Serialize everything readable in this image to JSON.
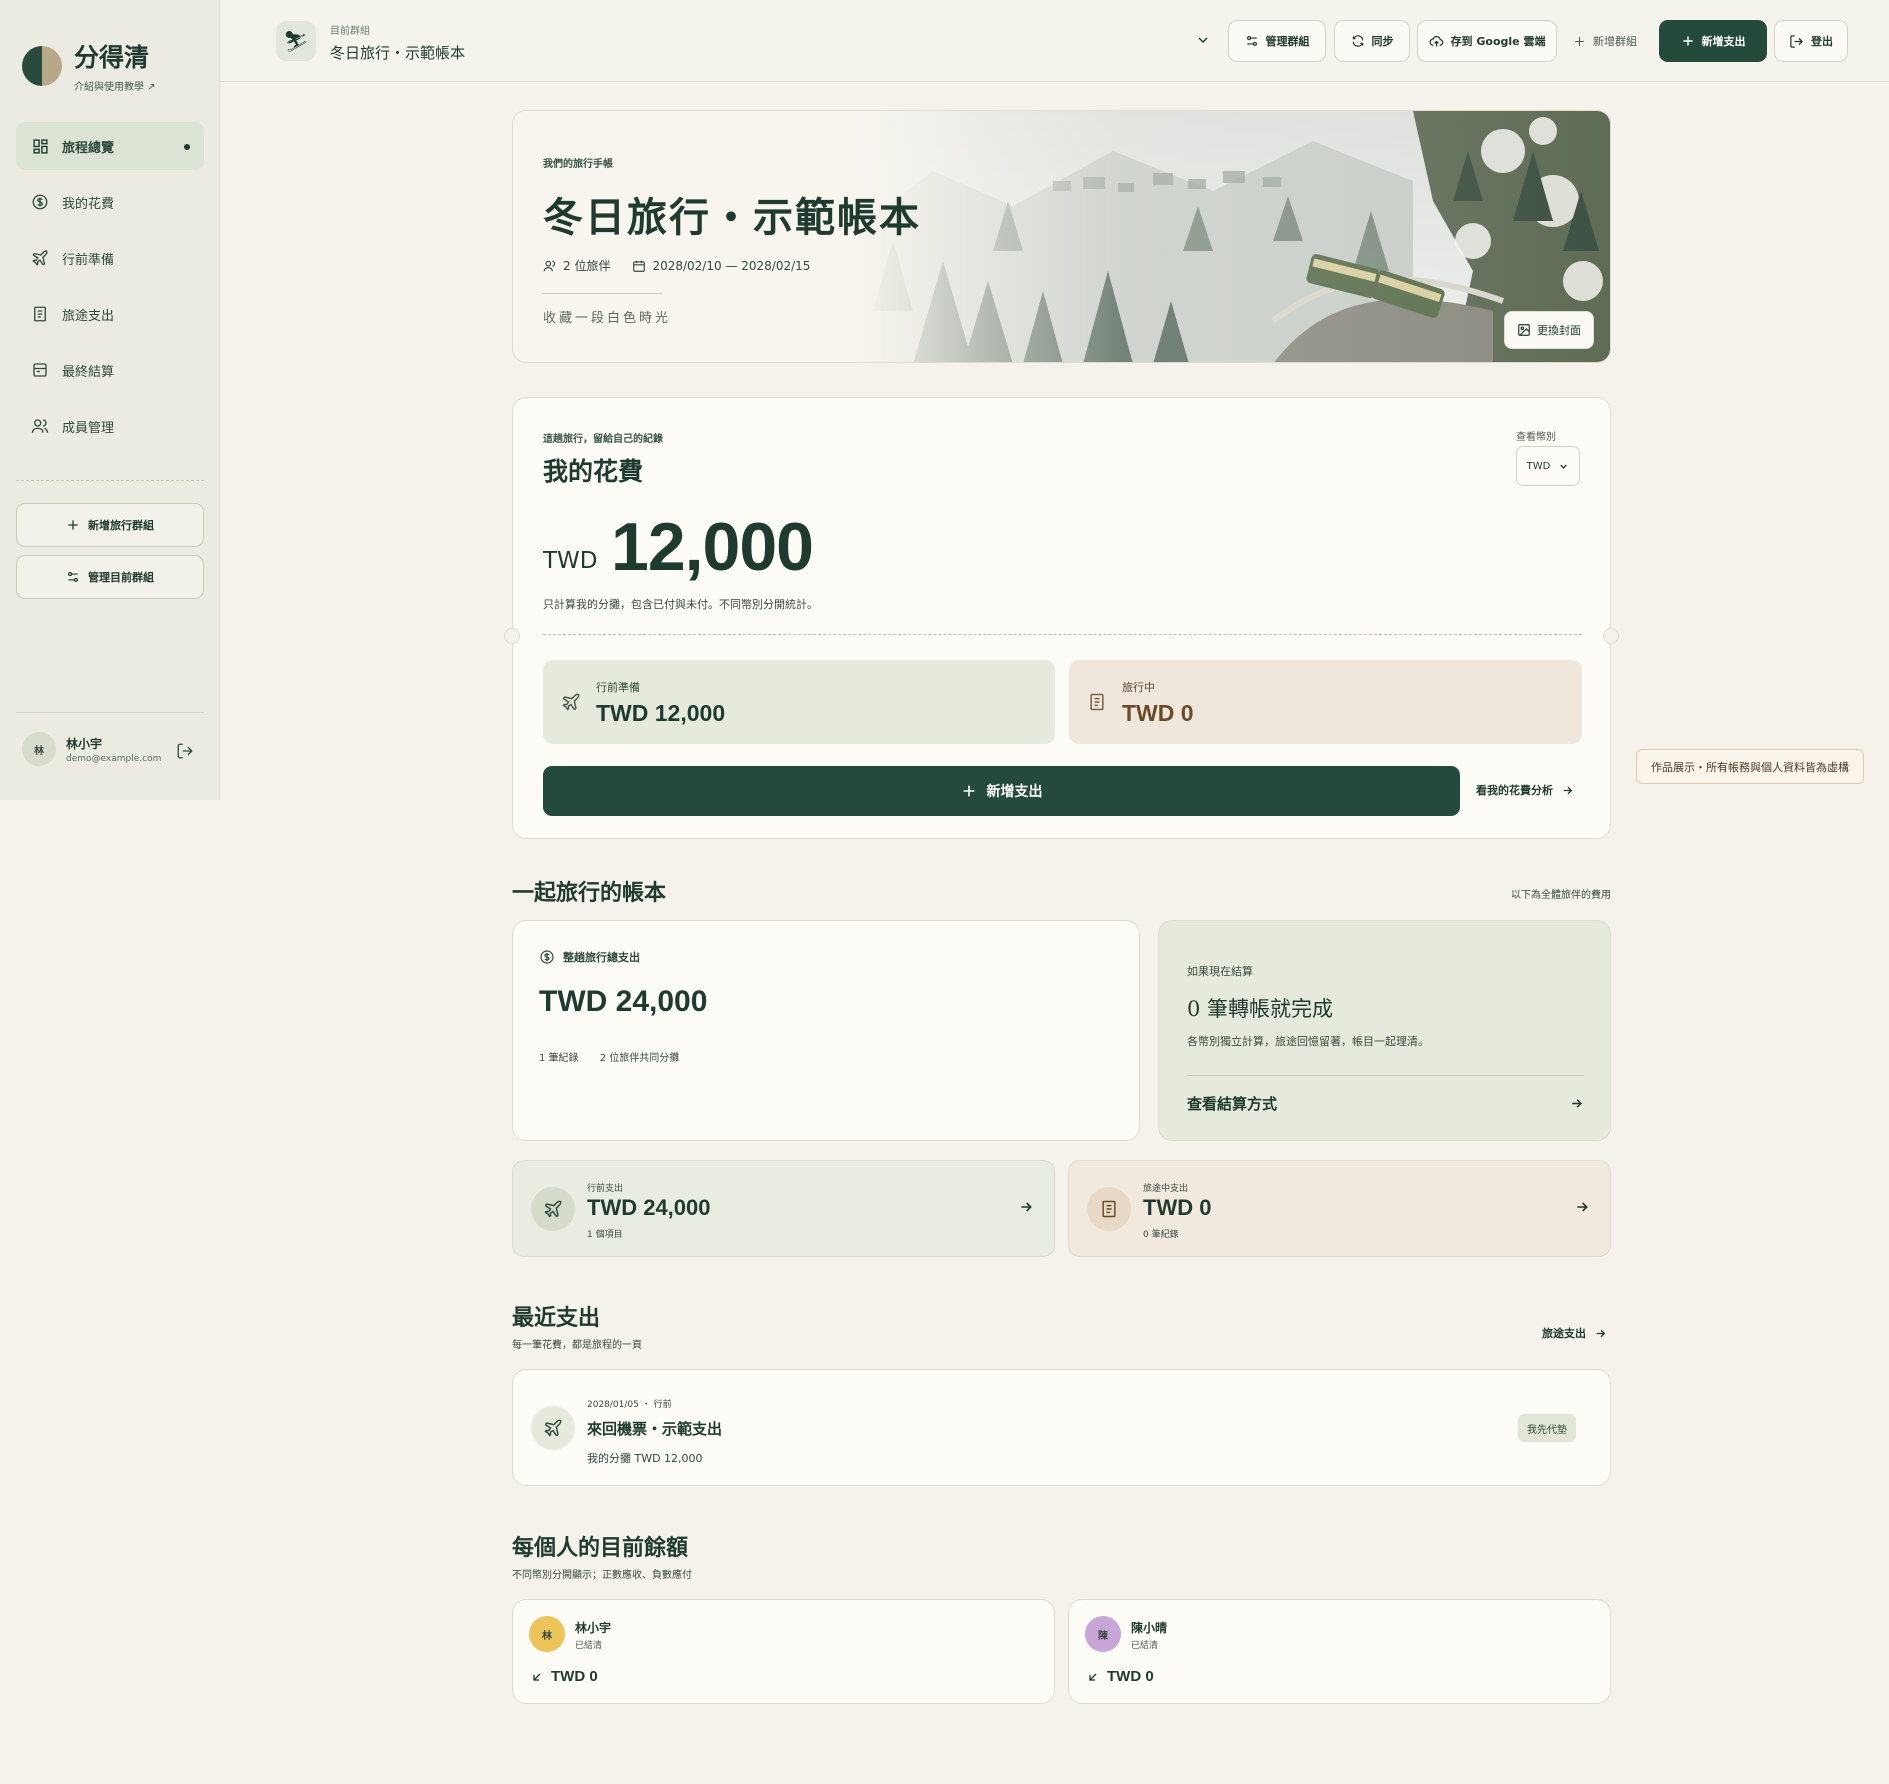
{
  "app": {
    "name": "分得清",
    "subtitle": "介紹與使用教學 ↗"
  },
  "sidebar": {
    "items": [
      {
        "label": "旅程總覽",
        "icon": "dashboard-icon",
        "active": true
      },
      {
        "label": "我的花費",
        "icon": "dollar-icon"
      },
      {
        "label": "行前準備",
        "icon": "plane-icon"
      },
      {
        "label": "旅途支出",
        "icon": "receipt-icon"
      },
      {
        "label": "最終結算",
        "icon": "wallet-icon"
      },
      {
        "label": "成員管理",
        "icon": "users-icon"
      }
    ],
    "new_group": "新增旅行群組",
    "manage_group": "管理目前群組",
    "user": {
      "initial": "林",
      "name": "林小宇",
      "email": "demo@example.com"
    }
  },
  "header": {
    "current_group_label": "目前群組",
    "current_group_name": "冬日旅行・示範帳本",
    "buttons": {
      "manage": "管理群組",
      "sync": "同步",
      "save_drive": "存到 Google 雲端",
      "new_group": "新增群組",
      "new_expense": "新增支出",
      "logout": "登出"
    }
  },
  "hero": {
    "label": "我們的旅行手帳",
    "title": "冬日旅行・示範帳本",
    "travelers": "2 位旅伴",
    "dates": "2028/02/10 — 2028/02/15",
    "tagline": "收藏一段白色時光",
    "change_cover": "更換封面"
  },
  "my_spending": {
    "kicker": "這趟旅行，留給自己的紀錄",
    "title": "我的花費",
    "currency_label": "查看幣別",
    "currency_selected": "TWD",
    "currency": "TWD",
    "amount": "12,000",
    "note": "只計算我的分攤，包含已付與未付。不同幣別分開統計。",
    "pre_trip_label": "行前準備",
    "pre_trip_value": "TWD 12,000",
    "during_label": "旅行中",
    "during_value": "TWD 0",
    "add_button": "新增支出",
    "analysis_link": "看我的花費分析"
  },
  "shared": {
    "title": "一起旅行的帳本",
    "note": "以下為全體旅伴的費用",
    "total_label": "整趟旅行總支出",
    "total_value": "TWD 24,000",
    "records": "1 筆紀錄",
    "sharers": "2 位旅伴共同分攤",
    "settle_kicker": "如果現在結算",
    "settle_title": "0 筆轉帳就完成",
    "settle_sub": "各幣別獨立計算，旅途回憶留著，帳目一起理清。",
    "settle_link": "查看結算方式",
    "pre_label": "行前支出",
    "pre_value": "TWD 24,000",
    "pre_count": "1 個項目",
    "during_label": "旅途中支出",
    "during_value": "TWD 0",
    "during_count": "0 筆紀錄"
  },
  "recent": {
    "title": "最近支出",
    "subtitle": "每一筆花費，都是旅程的一頁",
    "link": "旅途支出",
    "items": [
      {
        "meta": "2028/01/05 ・ 行前",
        "title": "來回機票・示範支出",
        "share": "我的分攤 TWD 12,000",
        "badge": "我先代墊"
      }
    ]
  },
  "balances": {
    "title": "每個人的目前餘額",
    "subtitle": "不同幣別分開顯示；正數應收、負數應付",
    "people": [
      {
        "initial": "林",
        "name": "林小宇",
        "status": "已結清",
        "amount": "TWD 0",
        "color": "#ecc45a"
      },
      {
        "initial": "陳",
        "name": "陳小晴",
        "status": "已結清",
        "amount": "TWD 0",
        "color": "#c8a6d8"
      }
    ]
  },
  "demo_note": "作品展示・所有帳務與個人資料皆為虛構",
  "colors": {
    "primary": "#244a3b",
    "sage": "#e6eadc",
    "sand": "#f0e7dc",
    "background": "#f4f2ea"
  }
}
